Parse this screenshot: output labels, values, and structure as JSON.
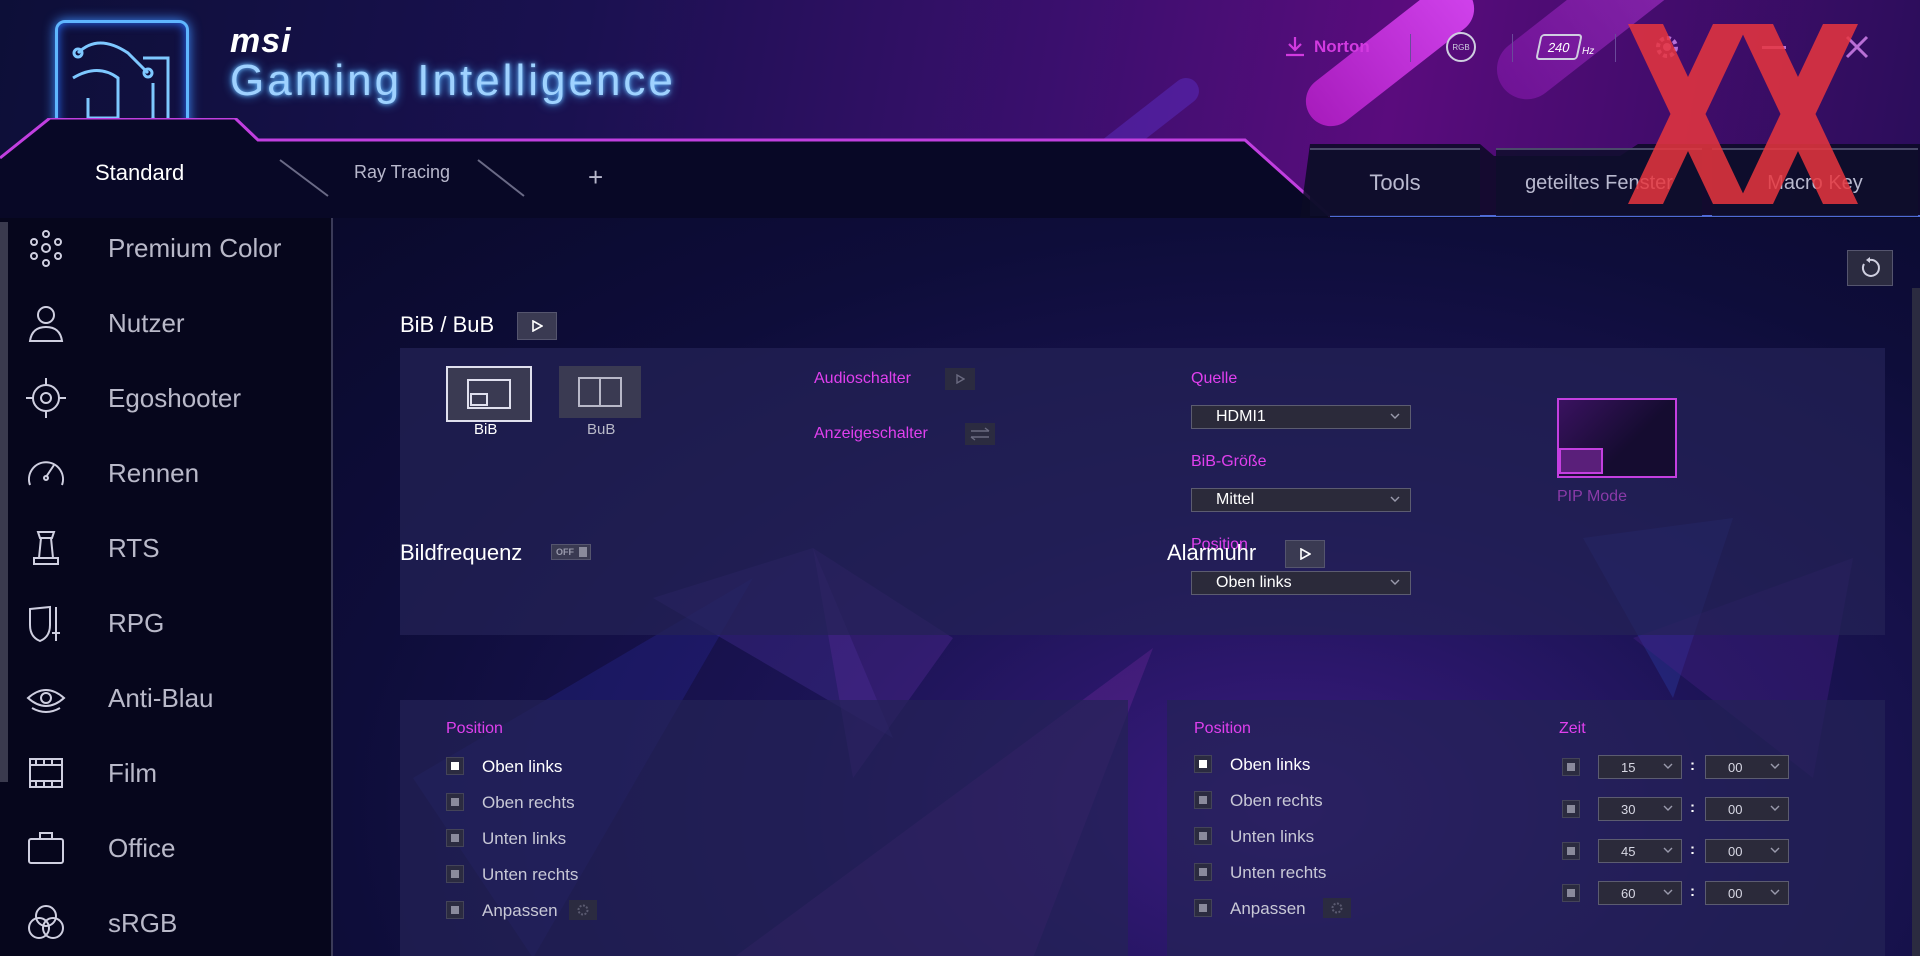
{
  "brand": {
    "small": "msi",
    "title": "Gaming Intelligence"
  },
  "header_tools": {
    "download_label": "Norton",
    "rgb_label": "RGB",
    "refresh_label": "240",
    "refresh_unit": "Hz"
  },
  "tabs": {
    "left": [
      "Standard",
      "Ray Tracing",
      "+"
    ],
    "right": [
      "Tools",
      "geteiltes Fenster",
      "Macro Key"
    ]
  },
  "sidebar": {
    "items": [
      {
        "label": "Premium Color",
        "icon": "premium-color-icon"
      },
      {
        "label": "Nutzer",
        "icon": "user-icon"
      },
      {
        "label": "Egoshooter",
        "icon": "crosshair-icon"
      },
      {
        "label": "Rennen",
        "icon": "speedometer-icon"
      },
      {
        "label": "RTS",
        "icon": "chess-piece-icon"
      },
      {
        "label": "RPG",
        "icon": "shield-sword-icon"
      },
      {
        "label": "Anti-Blau",
        "icon": "eye-icon"
      },
      {
        "label": "Film",
        "icon": "film-icon"
      },
      {
        "label": "Office",
        "icon": "briefcase-icon"
      },
      {
        "label": "sRGB",
        "icon": "color-circles-icon"
      }
    ]
  },
  "pip": {
    "title": "BiB / BuB",
    "modes": [
      {
        "label": "BiB",
        "selected": true
      },
      {
        "label": "BuB",
        "selected": false
      }
    ],
    "audio_switch": "Audioschalter",
    "display_switch": "Anzeigeschalter",
    "source_label": "Quelle",
    "source_value": "HDMI1",
    "size_label": "BiB-Größe",
    "size_value": "Mittel",
    "position_label": "Position",
    "position_value": "Oben links",
    "preview_caption": "PIP Mode"
  },
  "framerate": {
    "title": "Bildfrequenz",
    "toggle": "OFF",
    "position_label": "Position",
    "options": [
      {
        "label": "Oben links",
        "checked": true
      },
      {
        "label": "Oben rechts",
        "checked": false
      },
      {
        "label": "Unten links",
        "checked": false
      },
      {
        "label": "Unten rechts",
        "checked": false
      },
      {
        "label": "Anpassen",
        "checked": false
      }
    ]
  },
  "alarm": {
    "title": "Alarmuhr",
    "position_label": "Position",
    "time_label": "Zeit",
    "options": [
      {
        "label": "Oben links",
        "checked": true
      },
      {
        "label": "Oben rechts",
        "checked": false
      },
      {
        "label": "Unten links",
        "checked": false
      },
      {
        "label": "Unten rechts",
        "checked": false
      },
      {
        "label": "Anpassen",
        "checked": false
      }
    ],
    "times": [
      {
        "min": "15",
        "sec": "00"
      },
      {
        "min": "30",
        "sec": "00"
      },
      {
        "min": "45",
        "sec": "00"
      },
      {
        "min": "60",
        "sec": "00"
      }
    ],
    "separator": ":"
  },
  "colors": {
    "accent_pink": "#e040ee",
    "brand_blue": "#9fd2ff",
    "panel": "#242256"
  }
}
